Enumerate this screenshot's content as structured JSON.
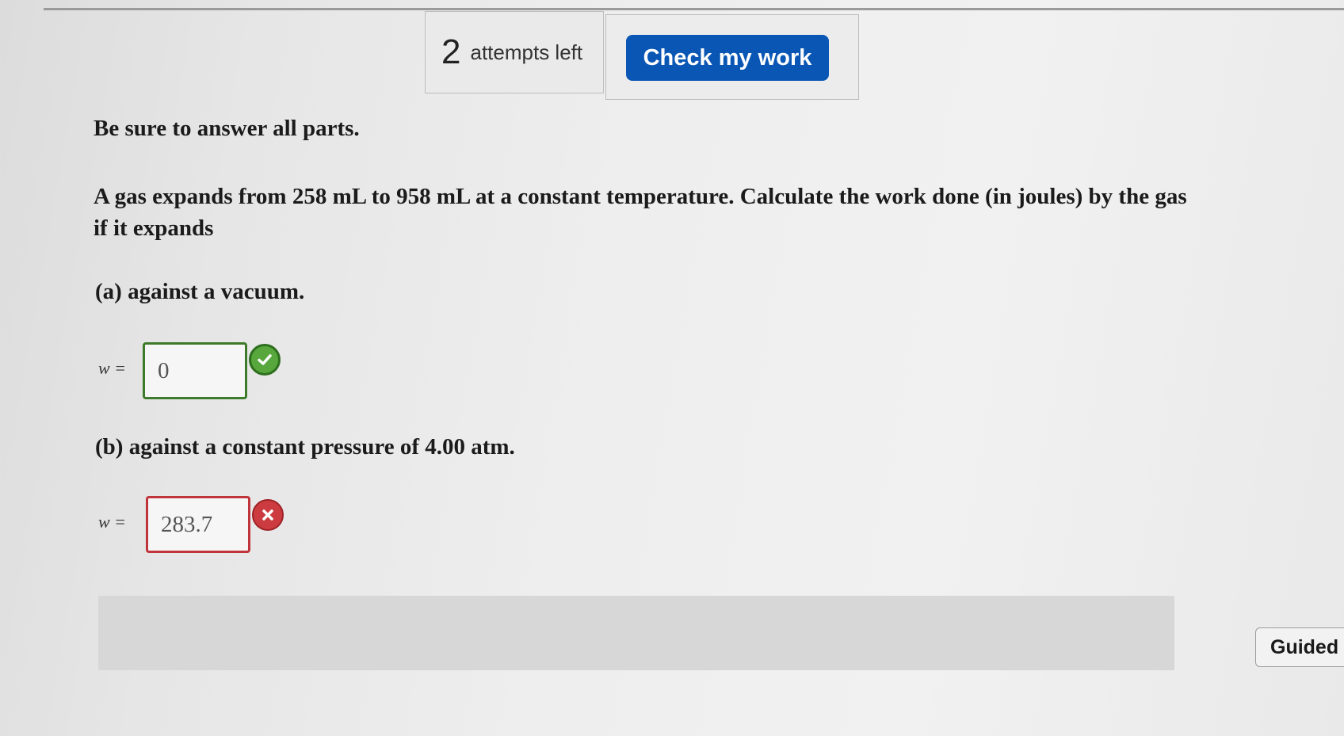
{
  "header": {
    "attempts_count": "2",
    "attempts_label": "attempts left",
    "check_button_label": "Check my work"
  },
  "question": {
    "instruction": "Be sure to answer all parts.",
    "prompt": "A gas expands from 258 mL to 958 mL at a constant temperature. Calculate the work done (in joules) by the gas if it expands",
    "parts": [
      {
        "label": "(a) against a vacuum.",
        "variable_label": "w =",
        "answer_value": "0",
        "status": "correct",
        "status_icon": "check-circle-icon"
      },
      {
        "label": "(b) against a constant pressure of 4.00 atm.",
        "variable_label": "w =",
        "answer_value": "283.7",
        "status": "incorrect",
        "status_icon": "x-circle-icon"
      }
    ]
  },
  "footer": {
    "guided_button_label": "Guided"
  },
  "colors": {
    "primary_button": "#0a56b5",
    "correct": "#58a73d",
    "incorrect": "#cc3b3f"
  }
}
